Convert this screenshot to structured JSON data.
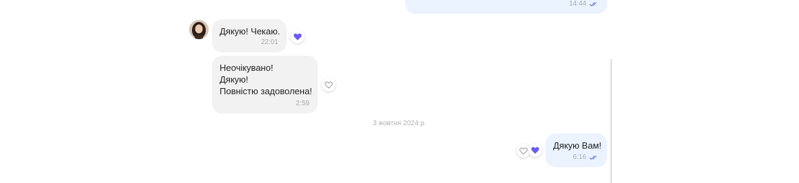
{
  "messages": {
    "top_out": {
      "time": "14:44"
    },
    "m1": {
      "text": "Дякую! Чекаю.",
      "time": "22:01"
    },
    "m2": {
      "lines": [
        "Неочікувано!",
        "Дякую!",
        "Повністю задоволена!"
      ],
      "time": "2:59"
    },
    "date_separator": "3 жовтня 2024 р.",
    "m3": {
      "text": "Дякую Вам!",
      "time": "6:16"
    }
  },
  "colors": {
    "incoming_bubble": "#f2f2f2",
    "outgoing_bubble": "#eaf3ff",
    "reaction_heart": "#6a5cf0",
    "read_ticks": "#6a7ee8"
  },
  "icons": {
    "read_receipt": "double-check-icon",
    "reaction": "heart-icon",
    "empty_reaction": "heart-outline-icon"
  }
}
